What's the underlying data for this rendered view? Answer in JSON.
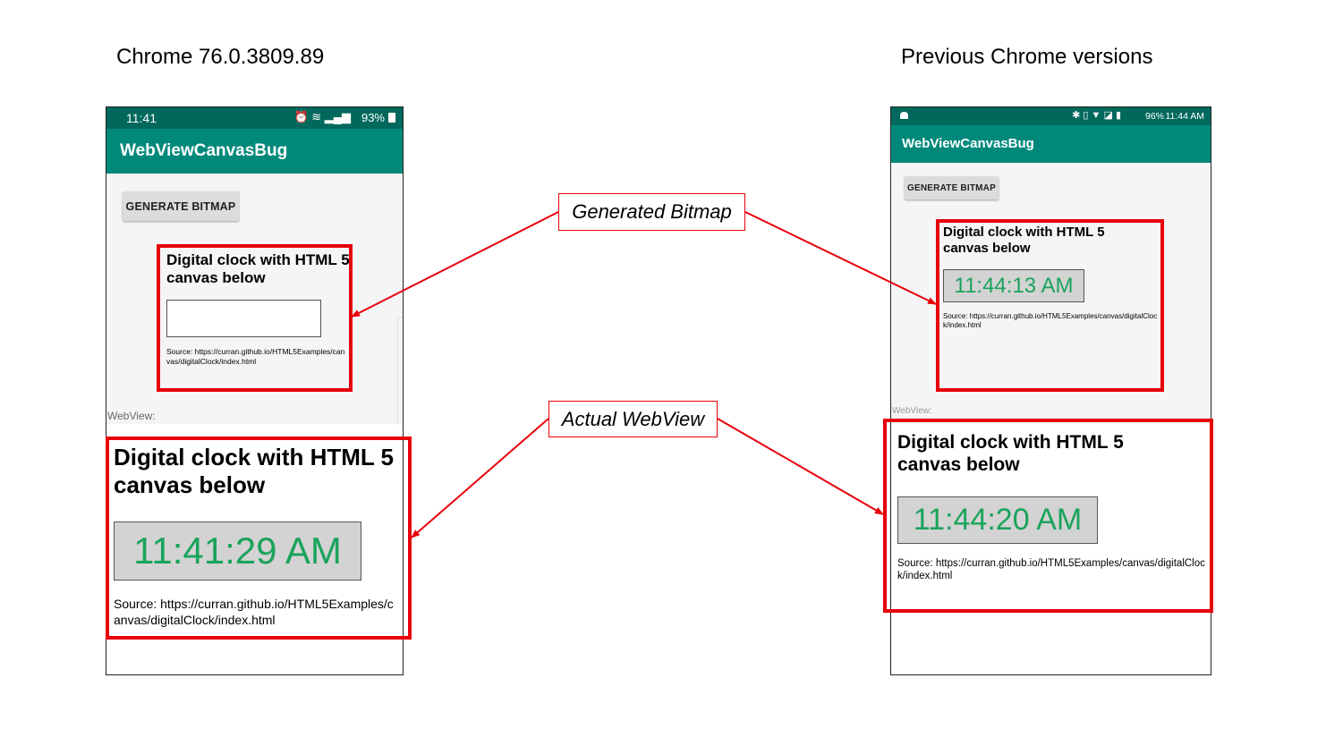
{
  "headings": {
    "left": "Chrome 76.0.3809.89",
    "right": "Previous Chrome versions"
  },
  "callouts": {
    "generated_bitmap": "Generated Bitmap",
    "actual_webview": "Actual WebView"
  },
  "left_phone": {
    "status_time": "11:41",
    "status_battery": "93%",
    "app_title": "WebViewCanvasBug",
    "button_label": "GENERATE BITMAP",
    "bitmap_title": "Digital clock with HTML 5 canvas below",
    "bitmap_source": "Source: https://curran.github.io/HTML5Examples/canvas/digitalClock/index.html",
    "webview_label": "WebView:",
    "webview_title": "Digital clock with HTML 5 canvas below",
    "webview_clock": "11:41:29 AM",
    "webview_source": "Source: https://curran.github.io/HTML5Examples/canvas/digitalClock/index.html"
  },
  "right_phone": {
    "status_battery": "96%",
    "status_time": "11:44 AM",
    "app_title": "WebViewCanvasBug",
    "button_label": "GENERATE BITMAP",
    "bitmap_title": "Digital clock with HTML 5 canvas below",
    "bitmap_clock": "11:44:13 AM",
    "bitmap_source": "Source: https://curran.github.io/HTML5Examples/canvas/digitalClock/index.html",
    "webview_label": "WebView:",
    "webview_title": "Digital clock with HTML 5 canvas below",
    "webview_clock": "11:44:20 AM",
    "webview_source": "Source: https://curran.github.io/HTML5Examples/canvas/digitalClock/index.html"
  },
  "colors": {
    "app_bar": "#00897b",
    "status_bar": "#00695c",
    "highlight_red": "#e8000b",
    "clock_green": "#1aa35c"
  }
}
